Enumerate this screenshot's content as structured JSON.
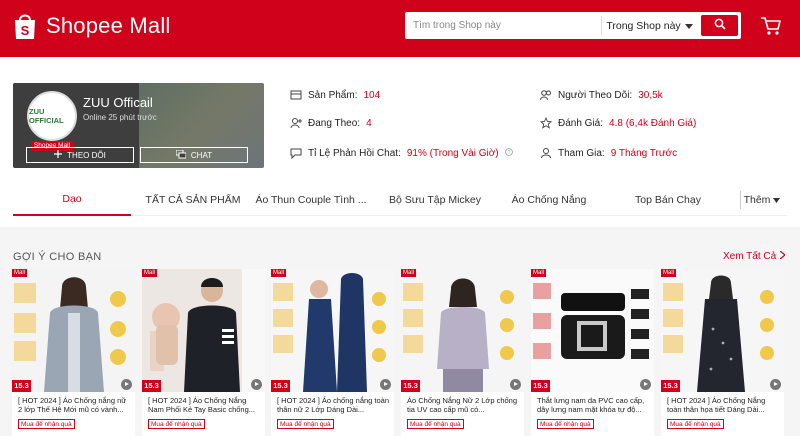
{
  "header": {
    "brand": "Shopee Mall",
    "search_placeholder": "Tìm trong Shop này",
    "search_scope": "Trong Shop này"
  },
  "shop": {
    "name": "ZUU Officail",
    "online": "Online 25 phút trước",
    "avatar_text": "ZUU OFFICIAL",
    "mall_badge": "Shopee Mall",
    "follow_label": "THEO DÕI",
    "chat_label": "CHAT"
  },
  "stats": {
    "products_label": "Sản Phẩm:",
    "products_value": "104",
    "following_label": "Đang Theo:",
    "following_value": "4",
    "chat_label": "Tỉ Lệ Phản Hồi Chat:",
    "chat_value": "91% (Trong Vài Giờ)",
    "followers_label": "Người Theo Dõi:",
    "followers_value": "30,5k",
    "rating_label": "Đánh Giá:",
    "rating_value": "4.8 (6,4k Đánh Giá)",
    "joined_label": "Tham Gia:",
    "joined_value": "9 Tháng Trước"
  },
  "tabs": [
    "Dạo",
    "TẤT CẢ SẢN PHẨM",
    "Áo Thun Couple Tình ...",
    "Bộ Sưu Tập Mickey",
    "Áo Chống Nắng",
    "Top Bán Chạy",
    "Thêm"
  ],
  "recommend": {
    "title": "GỢI Ý CHO BẠN",
    "see_all": "Xem Tất Cả"
  },
  "products": [
    {
      "name": "[ HOT 2024 ] Áo Chống nắng nữ 2 lớp Thế Hệ Mới mũ có vành...",
      "promo": "Mua để nhận quà",
      "badge": "15.3",
      "tag": "Mall"
    },
    {
      "name": "[ HOT 2024 ] Áo Chống Nắng Nam Phối Kẻ Tay Basic chống...",
      "promo": "Mua để nhận quà",
      "badge": "15.3",
      "tag": "Mall"
    },
    {
      "name": "[ HOT 2024 ] Áo chống nắng toàn thân nữ 2 Lớp Dáng Dài...",
      "promo": "Mua để nhận quà",
      "badge": "15.3",
      "tag": "Mall"
    },
    {
      "name": "Áo Chống Nắng Nữ 2 Lớp chống tia UV cao cấp mũ có...",
      "promo": "Mua để nhận quà",
      "badge": "15.3",
      "tag": "Mall"
    },
    {
      "name": "Thắt lưng nam da PVC cao cấp, dây lưng nam mặt khóa tự độ...",
      "promo": "Mua để nhận quà",
      "badge": "15.3",
      "tag": "Mall"
    },
    {
      "name": "[ HOT 2024 ] Áo Chống Nắng toàn thân họa tiết Dáng Dài...",
      "promo": "Mua để nhận quà",
      "badge": "15.3",
      "tag": "Mall"
    }
  ]
}
